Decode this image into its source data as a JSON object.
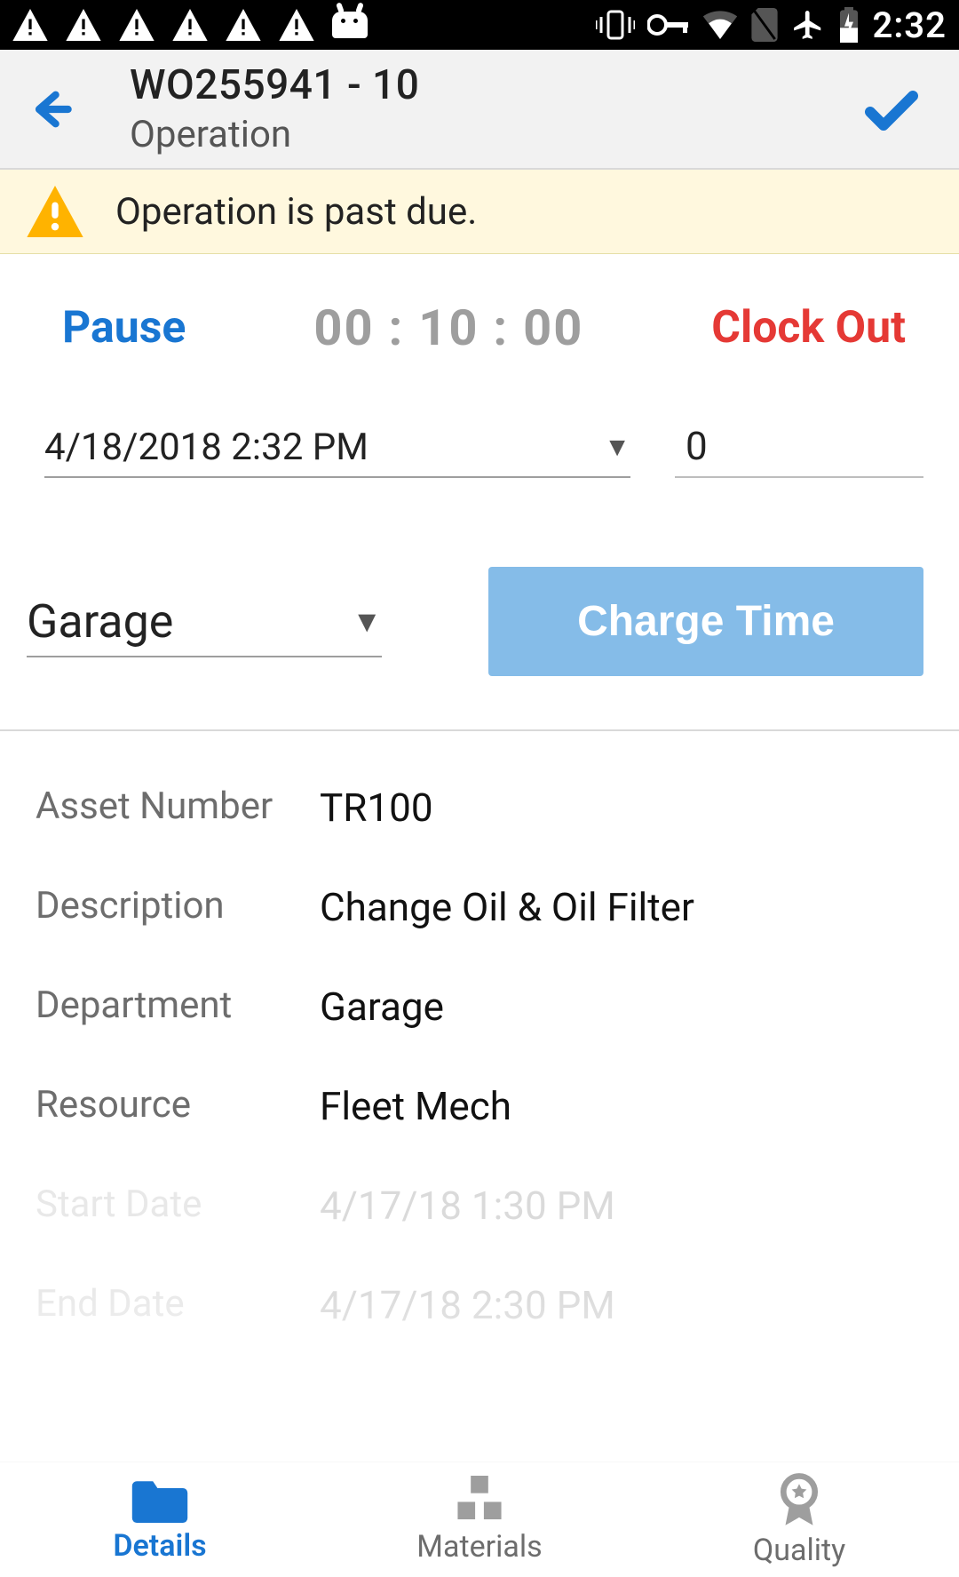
{
  "statusbar": {
    "time": "2:32"
  },
  "header": {
    "title": "WO255941 - 10",
    "subtitle": "Operation"
  },
  "banner": {
    "message": "Operation is past due."
  },
  "clockrow": {
    "pause": "Pause",
    "timer": "00 : 10 : 00",
    "clockout": "Clock Out"
  },
  "datetime": {
    "value": "4/18/2018 2:32 PM",
    "numeric": "0"
  },
  "department": {
    "selected": "Garage",
    "charge_label": "Charge Time"
  },
  "details": [
    {
      "label": "Asset Number",
      "value": "TR100"
    },
    {
      "label": "Description",
      "value": "Change Oil & Oil Filter"
    },
    {
      "label": "Department",
      "value": "Garage"
    },
    {
      "label": "Resource",
      "value": "Fleet Mech"
    },
    {
      "label": "Start Date",
      "value": "4/17/18 1:30 PM"
    },
    {
      "label": "End Date",
      "value": "4/17/18 2:30 PM"
    }
  ],
  "tabs": {
    "details": "Details",
    "materials": "Materials",
    "quality": "Quality"
  }
}
